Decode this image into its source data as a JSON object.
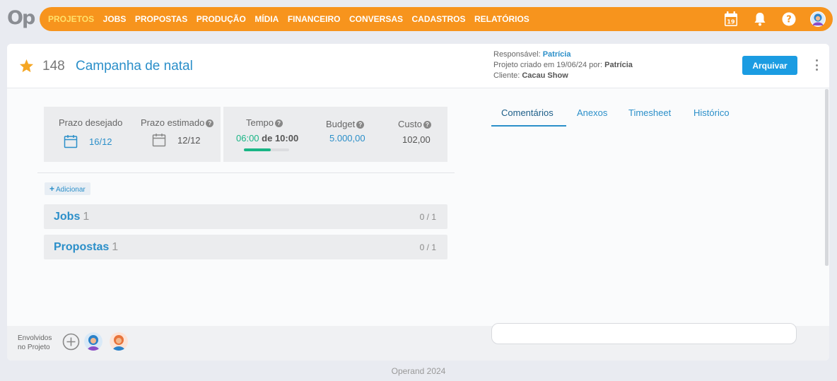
{
  "logo": "Op",
  "nav": {
    "items": [
      "PROJETOS",
      "JOBS",
      "PROPOSTAS",
      "PRODUÇÃO",
      "MÍDIA",
      "FINANCEIRO",
      "CONVERSAS",
      "CADASTROS",
      "RELATÓRIOS"
    ],
    "active": "PROJETOS",
    "calendar_day": "19",
    "help_symbol": "?"
  },
  "project": {
    "number": "148",
    "title": "Campanha de natal",
    "responsavel_label": "Responsável:",
    "responsavel": "Patrícia",
    "criado_label": "Projeto criado em 19/06/24 por:",
    "criado_por": "Patrícia",
    "cliente_label": "Cliente:",
    "cliente": "Cacau Show",
    "archive_label": "Arquivar"
  },
  "stats": {
    "prazo_desejado_label": "Prazo desejado",
    "prazo_desejado": "16/12",
    "prazo_estimado_label": "Prazo estimado",
    "prazo_estimado": "12/12",
    "tempo_label": "Tempo",
    "tempo_used": "06:00",
    "tempo_total": "de 10:00",
    "tempo_progress": 0.6,
    "budget_label": "Budget",
    "budget": "5.000,00",
    "custo_label": "Custo",
    "custo": "102,00"
  },
  "add_label": "Adicionar",
  "sections": [
    {
      "name": "Jobs",
      "count": "1",
      "ratio": "0 / 1"
    },
    {
      "name": "Propostas",
      "count": "1",
      "ratio": "0 / 1"
    }
  ],
  "tabs": [
    "Comentários",
    "Anexos",
    "Timesheet",
    "Histórico"
  ],
  "footer": {
    "envolvidos_line1": "Envolvidos",
    "envolvidos_line2": "no Projeto"
  },
  "copyright": "Operand 2024",
  "colors": {
    "accent": "#f7941d",
    "active_nav": "#ffe16a",
    "link": "#2b8fc9",
    "primary_button": "#1b9ce2",
    "progress": "#19b585",
    "star": "#f5a623"
  }
}
